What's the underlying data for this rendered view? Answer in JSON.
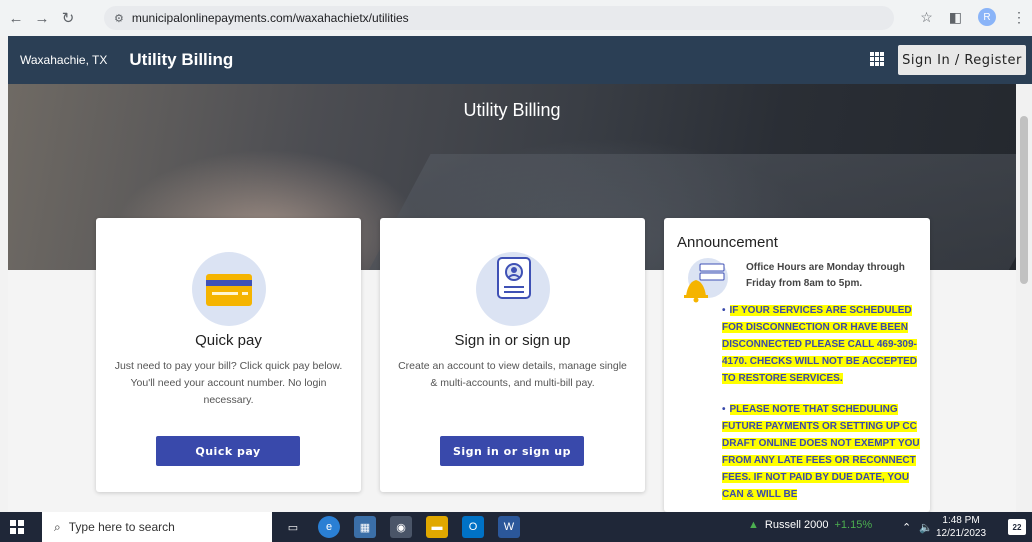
{
  "browser": {
    "url": "municipalonlinepayments.com/waxahachietx/utilities",
    "profile_initial": "R"
  },
  "header": {
    "city": "Waxahachie, TX",
    "title": "Utility Billing",
    "signin_label": "Sign In / Register"
  },
  "hero": {
    "title": "Utility Billing"
  },
  "cards": {
    "quick_pay": {
      "heading": "Quick pay",
      "description": "Just need to pay your bill? Click quick pay below. You'll need your account number. No login necessary.",
      "button": "Quick pay"
    },
    "sign_in": {
      "heading": "Sign in or sign up",
      "description": "Create an account to view details, manage single & multi-accounts, and multi-bill pay.",
      "button": "Sign in or sign up"
    }
  },
  "announcement": {
    "heading": "Announcement",
    "hours": "Office Hours are Monday through Friday from 8am to 5pm.",
    "items": [
      "IF YOUR SERVICES ARE SCHEDULED FOR DISCONNECTION OR HAVE BEEN DISCONNECTED PLEASE CALL 469-309-4170. CHECKS WILL NOT BE ACCEPTED TO RESTORE SERVICES.",
      "PLEASE NOTE THAT SCHEDULING FUTURE PAYMENTS OR SETTING UP CC DRAFT ONLINE DOES NOT EXEMPT YOU FROM ANY LATE FEES OR RECONNECT FEES. IF NOT PAID BY DUE DATE, YOU CAN & WILL BE"
    ]
  },
  "taskbar": {
    "search_placeholder": "Type here to search",
    "ticker_name": "Russell 2000",
    "ticker_change": "+1.15%",
    "time": "1:48 PM",
    "date": "12/21/2023",
    "notifications": "22"
  }
}
